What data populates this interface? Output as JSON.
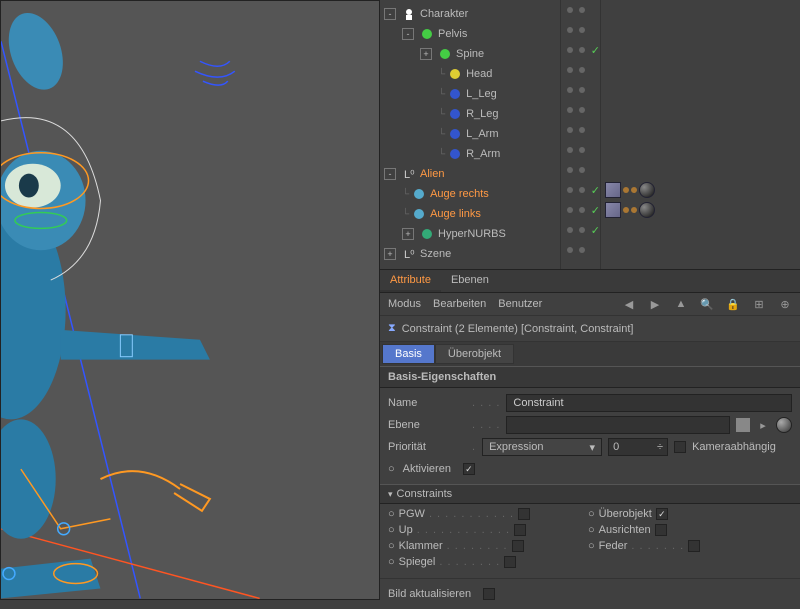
{
  "tree": {
    "items": [
      {
        "label": "Charakter",
        "icon": "character",
        "indent": 0,
        "exp": "-"
      },
      {
        "label": "Pelvis",
        "icon": "joint-g",
        "indent": 1,
        "exp": "-"
      },
      {
        "label": "Spine",
        "icon": "joint-g",
        "indent": 2,
        "exp": "+",
        "check": true
      },
      {
        "label": "Head",
        "icon": "joint-y",
        "indent": 3
      },
      {
        "label": "L_Leg",
        "icon": "joint-b",
        "indent": 3
      },
      {
        "label": "R_Leg",
        "icon": "joint-b",
        "indent": 3
      },
      {
        "label": "L_Arm",
        "icon": "joint-b",
        "indent": 3
      },
      {
        "label": "R_Arm",
        "icon": "joint-b",
        "indent": 3
      },
      {
        "label": "Alien",
        "icon": "null",
        "indent": 0,
        "exp": "-",
        "sel": true
      },
      {
        "label": "Auge rechts",
        "icon": "sphere",
        "indent": 1,
        "sel": true,
        "check": true,
        "tags": true
      },
      {
        "label": "Auge links",
        "icon": "sphere",
        "indent": 1,
        "sel": true,
        "check": true,
        "tags": true
      },
      {
        "label": "HyperNURBS",
        "icon": "hn",
        "indent": 1,
        "exp": "+",
        "check": true
      },
      {
        "label": "Szene",
        "icon": "null",
        "indent": 0,
        "exp": "+"
      }
    ]
  },
  "panel": {
    "tabs": {
      "attribute": "Attribute",
      "ebenen": "Ebenen"
    },
    "menu": {
      "modus": "Modus",
      "bearbeiten": "Bearbeiten",
      "benutzer": "Benutzer"
    },
    "obj_header": "Constraint (2 Elemente) [Constraint, Constraint]",
    "subtabs": {
      "basis": "Basis",
      "ueber": "Überobjekt"
    },
    "section_basis": "Basis-Eigenschaften",
    "name_label": "Name",
    "name_value": "Constraint",
    "ebene_label": "Ebene",
    "ebene_value": "",
    "prio_label": "Priorität",
    "prio_value": "Expression",
    "prio_num": "0",
    "kamera": "Kameraabhängig",
    "aktivieren": "Aktivieren",
    "section_cons": "Constraints",
    "cons": {
      "pgw": "PGW",
      "ueber": "Überobjekt",
      "up": "Up",
      "aus": "Ausrichten",
      "klammer": "Klammer",
      "feder": "Feder",
      "spiegel": "Spiegel"
    },
    "bild": "Bild aktualisieren"
  }
}
